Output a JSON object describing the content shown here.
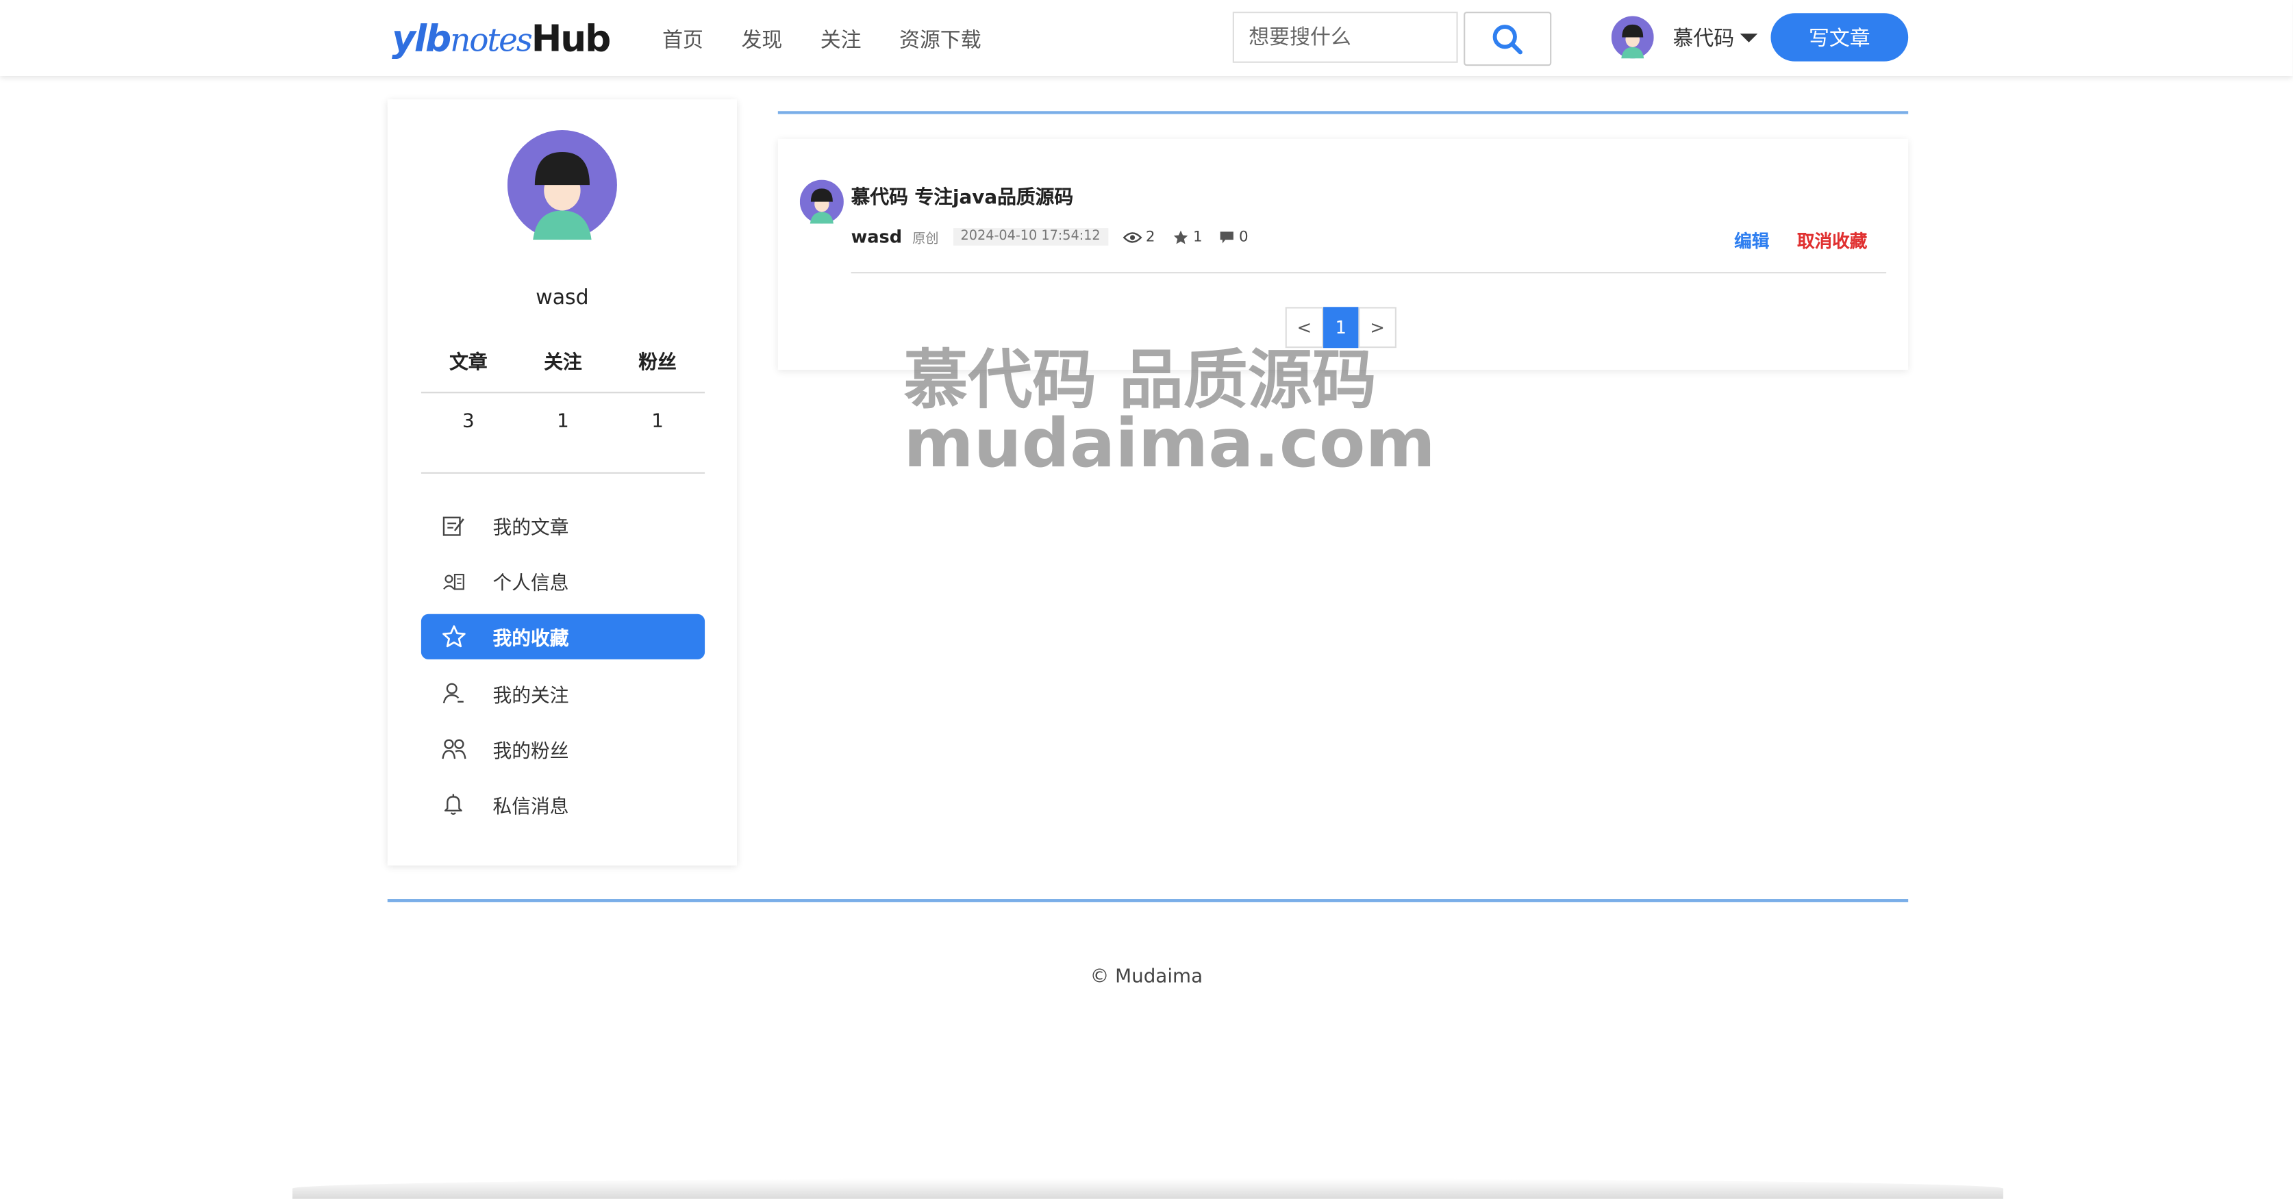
{
  "header": {
    "logo": {
      "part1": "ylb",
      "part2": "notes",
      "part3": "Hub"
    },
    "nav": [
      "首页",
      "发现",
      "关注",
      "资源下载"
    ],
    "search_placeholder": "想要搜什么",
    "user_name": "慕代码",
    "write_button": "写文章"
  },
  "sidebar": {
    "username": "wasd",
    "stats_labels": [
      "文章",
      "关注",
      "粉丝"
    ],
    "stats_values": [
      "3",
      "1",
      "1"
    ],
    "menu": [
      {
        "label": "我的文章",
        "icon": "edit-note-icon",
        "active": false
      },
      {
        "label": "个人信息",
        "icon": "id-card-icon",
        "active": false
      },
      {
        "label": "我的收藏",
        "icon": "star-icon",
        "active": true
      },
      {
        "label": "我的关注",
        "icon": "user-icon",
        "active": false
      },
      {
        "label": "我的粉丝",
        "icon": "users-icon",
        "active": false
      },
      {
        "label": "私信消息",
        "icon": "bell-icon",
        "active": false
      }
    ]
  },
  "post": {
    "title": "慕代码 专注java品质源码",
    "author": "wasd",
    "type": "原创",
    "date": "2024-04-10 17:54:12",
    "views": "2",
    "stars": "1",
    "comments": "0",
    "edit_label": "编辑",
    "uncollect_label": "取消收藏"
  },
  "pager": {
    "prev": "<",
    "current": "1",
    "next": ">"
  },
  "watermark": {
    "line1": "慕代码 品质源码",
    "line2": "mudaima.com"
  },
  "footer": {
    "copyright": "© Mudaima"
  },
  "colors": {
    "accent": "#2f7ff0",
    "danger": "#e03030",
    "avatar_bg": "#7b6fd6"
  }
}
